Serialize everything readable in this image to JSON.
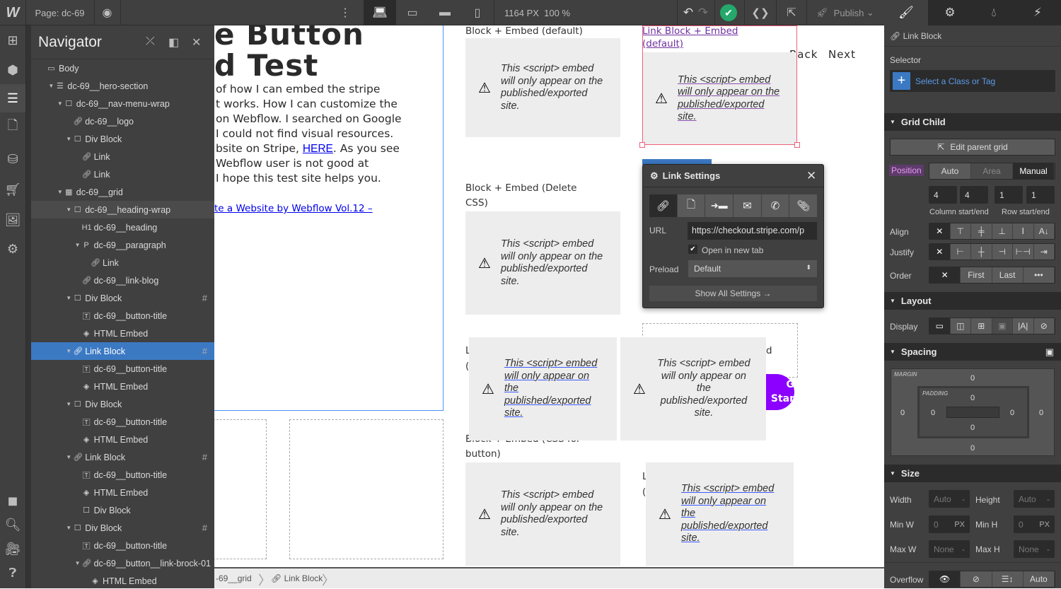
{
  "topbar": {
    "logo": "W",
    "page_label": "Page: dc-69",
    "canvas_width": "1164 PX",
    "zoom": "100 %",
    "publish": "Publish"
  },
  "left_rail": [
    "add-icon",
    "cube-icon",
    "navigator-icon",
    "pages-icon",
    "cms-icon",
    "ecommerce-icon",
    "assets-icon",
    "settings-icon"
  ],
  "left_rail_bottom": [
    "frame-icon",
    "search-icon",
    "video-icon",
    "help-icon"
  ],
  "navigator": {
    "title": "Navigator",
    "rows": [
      {
        "label": "Body",
        "level": 0,
        "icon": "body",
        "arrow": false
      },
      {
        "label": "dc-69__hero-section",
        "level": 1,
        "icon": "section",
        "arrow": true
      },
      {
        "label": "dc-69__nav-menu-wrap",
        "level": 2,
        "icon": "div",
        "arrow": true
      },
      {
        "label": "dc-69__logo",
        "level": 3,
        "icon": "link",
        "arrow": false
      },
      {
        "label": "Div Block",
        "level": 3,
        "icon": "div",
        "arrow": true
      },
      {
        "label": "Link",
        "level": 4,
        "icon": "link",
        "arrow": false
      },
      {
        "label": "Link",
        "level": 4,
        "icon": "link",
        "arrow": false
      },
      {
        "label": "dc-69__grid",
        "level": 2,
        "icon": "grid",
        "arrow": true
      },
      {
        "label": "dc-69__heading-wrap",
        "level": 3,
        "icon": "div",
        "arrow": true,
        "state": "hover"
      },
      {
        "label": "dc-69__heading",
        "level": 4,
        "icon": "h1",
        "arrow": false
      },
      {
        "label": "dc-69__paragraph",
        "level": 4,
        "icon": "p",
        "arrow": true
      },
      {
        "label": "Link",
        "level": 5,
        "icon": "link",
        "arrow": false
      },
      {
        "label": "dc-69__link-blog",
        "level": 4,
        "icon": "link",
        "arrow": false
      },
      {
        "label": "Div Block",
        "level": 3,
        "icon": "div",
        "arrow": true,
        "grid_child": true
      },
      {
        "label": "dc-69__button-title",
        "level": 4,
        "icon": "text",
        "arrow": false
      },
      {
        "label": "HTML Embed",
        "level": 4,
        "icon": "embed",
        "arrow": false
      },
      {
        "label": "Link Block",
        "level": 3,
        "icon": "link",
        "arrow": true,
        "grid_child": true,
        "state": "selected"
      },
      {
        "label": "dc-69__button-title",
        "level": 4,
        "icon": "text",
        "arrow": false
      },
      {
        "label": "HTML Embed",
        "level": 4,
        "icon": "embed",
        "arrow": false
      },
      {
        "label": "Div Block",
        "level": 3,
        "icon": "div",
        "arrow": true
      },
      {
        "label": "dc-69__button-title",
        "level": 4,
        "icon": "text",
        "arrow": false
      },
      {
        "label": "HTML Embed",
        "level": 4,
        "icon": "embed",
        "arrow": false
      },
      {
        "label": "Link Block",
        "level": 3,
        "icon": "link",
        "arrow": true,
        "grid_child": true
      },
      {
        "label": "dc-69__button-title",
        "level": 4,
        "icon": "text",
        "arrow": false
      },
      {
        "label": "HTML Embed",
        "level": 4,
        "icon": "embed",
        "arrow": false
      },
      {
        "label": "Div Block",
        "level": 4,
        "icon": "div",
        "arrow": false
      },
      {
        "label": "Div Block",
        "level": 3,
        "icon": "div",
        "arrow": true,
        "grid_child": true
      },
      {
        "label": "dc-69__button-title",
        "level": 4,
        "icon": "text",
        "arrow": false
      },
      {
        "label": "dc-69__button__link-brock-01",
        "level": 4,
        "icon": "link",
        "arrow": true
      },
      {
        "label": "HTML Embed",
        "level": 5,
        "icon": "embed",
        "arrow": false
      }
    ]
  },
  "canvas": {
    "heading_lines": [
      "e Button",
      "d Test"
    ],
    "paragraph_lines": [
      "of how I can embed the stripe",
      "t works. How I can customize the",
      "on Webflow. I searched on Google",
      "I could not find visual resources.",
      "bsite on Stripe, ",
      "Webflow user is not good at",
      "I hope this test site helps you."
    ],
    "paragraph_link": "HERE",
    "paragraph_after_link": ". As you see",
    "blog_link": "te a Website by Webflow Vol.12 –",
    "labels": {
      "block_default": "Block + Embed (default)",
      "link_block_default_1": "Link Block + Embed",
      "link_block_default_2": "(default)",
      "delete_css_1": "Block + Embed (Delete",
      "delete_css_2": "CSS)",
      "css_button_1": "Block + Embed (CSS for",
      "css_button_2": "button)",
      "partial_l": "L",
      "partial_paren": "(",
      "partial_d": "d"
    },
    "nav_links": [
      "Back",
      "Next"
    ],
    "embed_message": "This <script> embed will only appear on the published/exported site.",
    "cta_button": [
      "G",
      "Star"
    ],
    "cta_color": "#8b00ff",
    "selection_color": "#f0607a"
  },
  "link_settings": {
    "title": "Link Settings",
    "types": [
      "url-link-icon",
      "page-icon",
      "section-icon",
      "email-icon",
      "phone-icon",
      "file-icon"
    ],
    "url_label": "URL",
    "url_value": "https://checkout.stripe.com/p",
    "open_new_tab": "Open in new tab",
    "open_new_tab_checked": true,
    "preload_label": "Preload",
    "preload_value": "Default",
    "show_all": "Show All Settings →"
  },
  "breadcrumb": [
    "-69__grid",
    "Link Block"
  ],
  "right_panel": {
    "element": "Link Block",
    "selector_label": "Selector",
    "selector_placeholder": "Select a Class or Tag",
    "grid_child": {
      "title": "Grid Child",
      "edit_parent": "Edit parent grid",
      "position_label": "Position",
      "position_options": [
        "Auto",
        "Area",
        "Manual"
      ],
      "position_selected": "Manual",
      "column_start": "4",
      "column_end": "4",
      "row_start": "1",
      "row_end": "1",
      "column_caption": "Column start/end",
      "row_caption": "Row start/end",
      "align_label": "Align",
      "justify_label": "Justify",
      "order_label": "Order",
      "order_options": [
        "✕",
        "First",
        "Last",
        "•••"
      ]
    },
    "layout": {
      "title": "Layout",
      "display_label": "Display",
      "display_selected": "block"
    },
    "spacing": {
      "title": "Spacing",
      "margin_label": "MARGIN",
      "padding_label": "PADDING",
      "margin": {
        "top": "0",
        "right": "0",
        "bottom": "0",
        "left": "0"
      },
      "padding": {
        "top": "0",
        "right": "0",
        "bottom": "0",
        "left": "0"
      }
    },
    "size": {
      "title": "Size",
      "width_label": "Width",
      "width": "Auto",
      "height_label": "Height",
      "height": "Auto",
      "min_w_label": "Min W",
      "min_w": "0",
      "min_h_label": "Min H",
      "min_h": "0",
      "unit": "PX",
      "max_w_label": "Max W",
      "max_w": "None",
      "max_h_label": "Max H",
      "max_h": "None",
      "dash": "-"
    },
    "overflow": {
      "label": "Overflow",
      "options": [
        "visible",
        "hidden",
        "scroll",
        "Auto"
      ],
      "selected": "visible"
    }
  }
}
